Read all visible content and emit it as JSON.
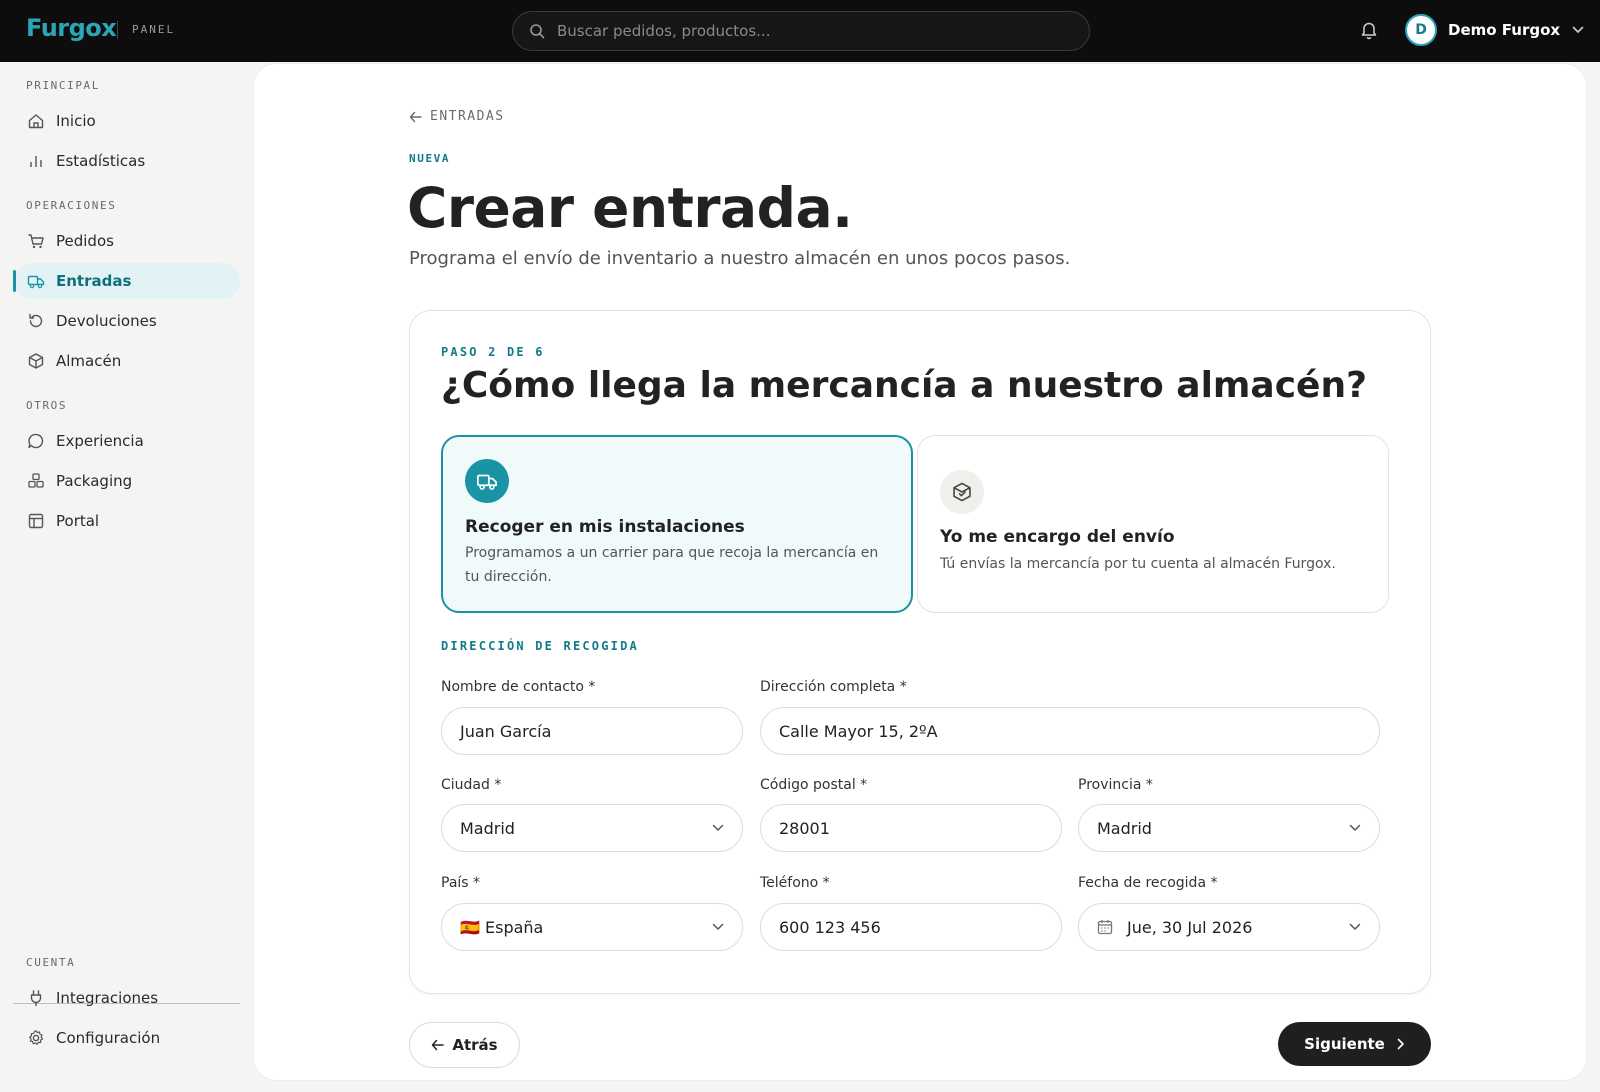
{
  "app": {
    "brand": "Furgox",
    "section": "PANEL"
  },
  "search": {
    "placeholder": "Buscar pedidos, productos..."
  },
  "user": {
    "initial": "D",
    "name": "Demo Furgox"
  },
  "sidebar": {
    "groups": [
      {
        "label": "PRINCIPAL",
        "items": [
          {
            "label": "Inicio",
            "icon": "home-icon"
          },
          {
            "label": "Estadísticas",
            "icon": "bar-chart-icon"
          }
        ]
      },
      {
        "label": "OPERACIONES",
        "items": [
          {
            "label": "Pedidos",
            "icon": "cart-icon"
          },
          {
            "label": "Entradas",
            "icon": "truck-icon",
            "active": true
          },
          {
            "label": "Devoluciones",
            "icon": "return-icon"
          },
          {
            "label": "Almacén",
            "icon": "box-icon"
          }
        ]
      },
      {
        "label": "OTROS",
        "items": [
          {
            "label": "Experiencia",
            "icon": "chat-icon"
          },
          {
            "label": "Packaging",
            "icon": "packages-icon"
          },
          {
            "label": "Portal",
            "icon": "layout-icon"
          }
        ]
      },
      {
        "label": "CUENTA",
        "items": [
          {
            "label": "Integraciones",
            "icon": "plug-icon"
          },
          {
            "label": "Configuración",
            "icon": "gear-icon"
          }
        ]
      }
    ]
  },
  "page": {
    "back_label": "ENTRADAS",
    "eyebrow": "NUEVA",
    "title": "Crear entrada.",
    "subtitle": "Programa el envío de inventario a nuestro almacén en unos pocos pasos."
  },
  "step": {
    "label": "PASO 2 DE 6",
    "title": "¿Cómo llega la mercancía a nuestro almacén?",
    "options": [
      {
        "title": "Recoger en mis instalaciones",
        "description": "Programamos a un carrier para que recoja la mercancía en tu dirección.",
        "selected": true
      },
      {
        "title": "Yo me encargo del envío",
        "description": "Tú envías la mercancía por tu cuenta al almacén Furgox.",
        "selected": false
      }
    ]
  },
  "address": {
    "section_label": "DIRECCIÓN DE RECOGIDA",
    "contact_name": {
      "label": "Nombre de contacto *",
      "value": "Juan García"
    },
    "full_address": {
      "label": "Dirección completa *",
      "value": "Calle Mayor 15, 2ºA"
    },
    "city": {
      "label": "Ciudad *",
      "value": "Madrid"
    },
    "postal_code": {
      "label": "Código postal *",
      "value": "28001"
    },
    "province": {
      "label": "Provincia *",
      "value": "Madrid"
    },
    "country": {
      "label": "País *",
      "value": "🇪🇸 España"
    },
    "phone": {
      "label": "Teléfono *",
      "value": "600 123 456"
    },
    "pickup_date": {
      "label": "Fecha de recogida *",
      "value": "Jue, 30 Jul 2026"
    }
  },
  "actions": {
    "back": "Atrás",
    "next": "Siguiente"
  },
  "colors": {
    "accent": "#1a93a4",
    "accent_dark": "#127b8a",
    "topbar": "#0d0d0d",
    "primary_button": "#1f1f1f"
  }
}
